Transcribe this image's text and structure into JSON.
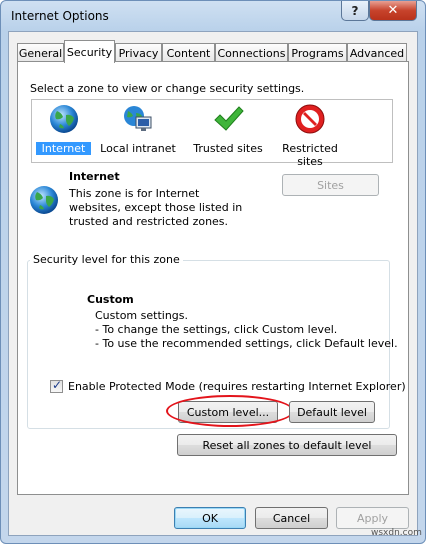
{
  "window": {
    "title": "Internet Options",
    "help_glyph": "?",
    "close_glyph": "✕"
  },
  "tabs": [
    {
      "label": "General"
    },
    {
      "label": "Security"
    },
    {
      "label": "Privacy"
    },
    {
      "label": "Content"
    },
    {
      "label": "Connections"
    },
    {
      "label": "Programs"
    },
    {
      "label": "Advanced"
    }
  ],
  "active_tab": "Security",
  "security": {
    "prompt": "Select a zone to view or change security settings.",
    "zones": [
      {
        "label": "Internet",
        "icon": "globe-icon",
        "selected": true
      },
      {
        "label": "Local intranet",
        "icon": "intranet-icon",
        "selected": false
      },
      {
        "label": "Trusted sites",
        "icon": "checkmark-icon",
        "selected": false
      },
      {
        "label": "Restricted sites",
        "icon": "restricted-icon",
        "selected": false
      }
    ],
    "zone_title": "Internet",
    "zone_description": "This zone is for Internet websites, except those listed in trusted and restricted zones.",
    "sites_label": "Sites",
    "group_title": "Security level for this zone",
    "level_title": "Custom",
    "level_lines": [
      "Custom settings.",
      "- To change the settings, click Custom level.",
      "- To use the recommended settings, click Default level."
    ],
    "protected_mode_label": "Enable Protected Mode (requires restarting Internet Explorer)",
    "protected_mode_checked": true,
    "custom_level_label": "Custom level...",
    "default_level_label": "Default level",
    "reset_label": "Reset all zones to default level"
  },
  "footer": {
    "ok_label": "OK",
    "cancel_label": "Cancel",
    "apply_label": "Apply"
  },
  "colors": {
    "selection": "#3399ff",
    "annotation": "#e3141b",
    "close_button": "#c7432c"
  },
  "watermark": "wsxdn.com"
}
